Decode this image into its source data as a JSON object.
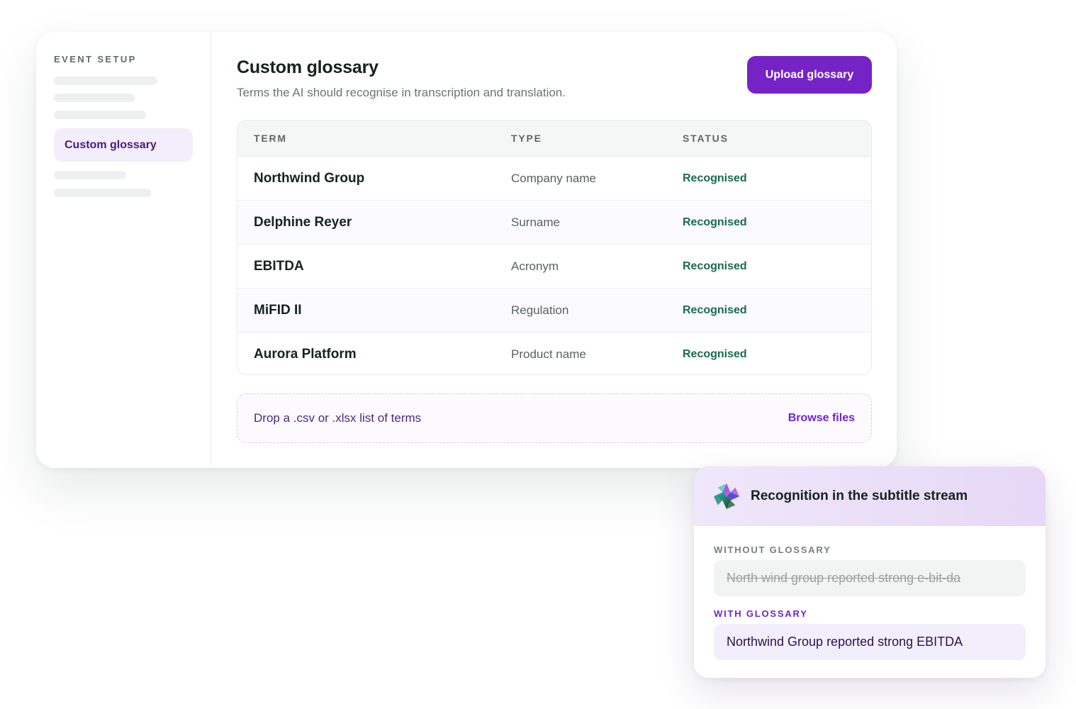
{
  "sidebar": {
    "heading": "EVENT SETUP",
    "active_item": "Custom glossary"
  },
  "main": {
    "title": "Custom glossary",
    "subtitle": "Terms the AI should recognise in transcription and translation.",
    "upload_button": "Upload glossary"
  },
  "table": {
    "headers": [
      "TERM",
      "TYPE",
      "STATUS"
    ],
    "rows": [
      {
        "term": "Northwind Group",
        "type": "Company name",
        "status": "Recognised"
      },
      {
        "term": "Delphine Reyer",
        "type": "Surname",
        "status": "Recognised"
      },
      {
        "term": "EBITDA",
        "type": "Acronym",
        "status": "Recognised"
      },
      {
        "term": "MiFID II",
        "type": "Regulation",
        "status": "Recognised"
      },
      {
        "term": "Aurora Platform",
        "type": "Product name",
        "status": "Recognised"
      }
    ]
  },
  "dropzone": {
    "text": "Drop a .csv or .xlsx list of terms",
    "browse": "Browse files"
  },
  "card": {
    "title": "Recognition in the subtitle stream",
    "logo_icon": "sparkle-logo-icon",
    "without_label": "WITHOUT GLOSSARY",
    "without_text": "North wind group reported strong e-bit-da",
    "with_label": "WITH GLOSSARY",
    "with_text": "Northwind Group reported strong EBITDA"
  },
  "colors": {
    "accent": "#7523c6",
    "status_green": "#1a6b4e",
    "active_nav_bg": "#f3eefb"
  }
}
